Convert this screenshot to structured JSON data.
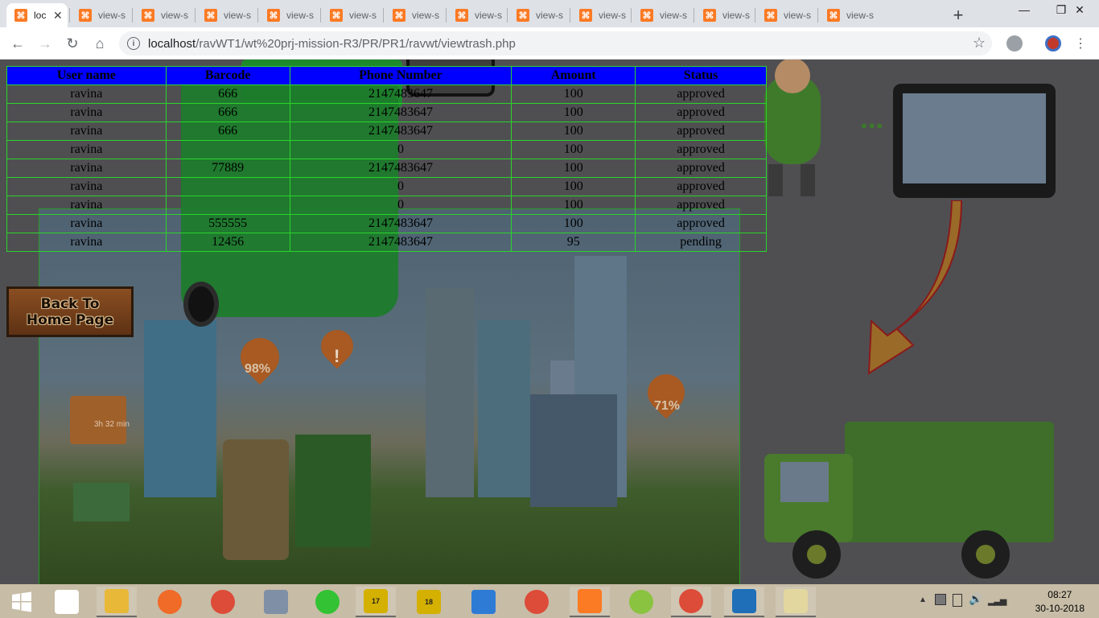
{
  "browser": {
    "tabs": [
      {
        "title": "loc",
        "active": true
      },
      {
        "title": "view-s"
      },
      {
        "title": "view-s"
      },
      {
        "title": "view-s"
      },
      {
        "title": "view-s"
      },
      {
        "title": "view-s"
      },
      {
        "title": "view-s"
      },
      {
        "title": "view-s"
      },
      {
        "title": "view-s"
      },
      {
        "title": "view-s"
      },
      {
        "title": "view-s"
      },
      {
        "title": "view-s"
      },
      {
        "title": "view-s"
      },
      {
        "title": "view-s"
      }
    ],
    "new_tab": "+",
    "url_host": "localhost",
    "url_path": "/ravWT1/wt%20prj-mission-R3/PR/PR1/ravwt/viewtrash.php",
    "win_min": "—",
    "win_max": "❐",
    "win_close": "✕"
  },
  "table": {
    "headers": [
      "User name",
      "Barcode",
      "Phone Number",
      "Amount",
      "Status"
    ],
    "rows": [
      [
        "ravina",
        "666",
        "2147483647",
        "100",
        "approved"
      ],
      [
        "ravina",
        "666",
        "2147483647",
        "100",
        "approved"
      ],
      [
        "ravina",
        "666",
        "2147483647",
        "100",
        "approved"
      ],
      [
        "ravina",
        "",
        "0",
        "100",
        "approved"
      ],
      [
        "ravina",
        "77889",
        "2147483647",
        "100",
        "approved"
      ],
      [
        "ravina",
        "",
        "0",
        "100",
        "approved"
      ],
      [
        "ravina",
        "",
        "0",
        "100",
        "approved"
      ],
      [
        "ravina",
        "555555",
        "2147483647",
        "100",
        "approved"
      ],
      [
        "ravina",
        "12456",
        "2147483647",
        "95",
        "pending"
      ]
    ]
  },
  "back_button": {
    "line1": "Back To",
    "line2": "Home Page"
  },
  "illustration": {
    "pct_left": "98%",
    "pct_right": "71%",
    "alert": "!",
    "timer": "3h 32 min"
  },
  "taskbar": {
    "apps": [
      {
        "name": "file-icon",
        "color": "#ffffff"
      },
      {
        "name": "file-explorer-icon",
        "color": "#e8b838"
      },
      {
        "name": "uc-browser-icon",
        "color": "#f06a28"
      },
      {
        "name": "chrome-icon",
        "color": "#dd4b39"
      },
      {
        "name": "network-monitor-icon",
        "color": "#7f8fa6"
      },
      {
        "name": "sync-icon",
        "color": "#33c233"
      },
      {
        "name": "vs-17-icon",
        "color": "#d4b000",
        "label": "17"
      },
      {
        "name": "vs-18-icon",
        "color": "#d4b000",
        "label": "18"
      },
      {
        "name": "xilinx-icon",
        "color": "#2e7bd6"
      },
      {
        "name": "chrome-icon-2",
        "color": "#dd4b39"
      },
      {
        "name": "xampp-icon",
        "color": "#fb7a24"
      },
      {
        "name": "app-green-icon",
        "color": "#8ac33f"
      },
      {
        "name": "chrome-icon-3",
        "color": "#dd4b39"
      },
      {
        "name": "photos-icon",
        "color": "#1e6fb8"
      },
      {
        "name": "paint-icon",
        "color": "#e3d7a0"
      }
    ],
    "time": "08:27",
    "date": "30-10-2018"
  }
}
